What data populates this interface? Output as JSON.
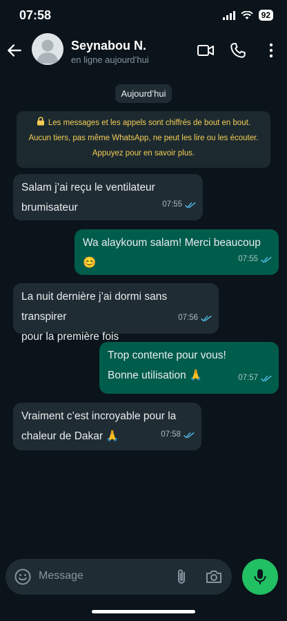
{
  "status_bar": {
    "time": "07:58",
    "battery": "92"
  },
  "header": {
    "contact_name": "Seynabou N.",
    "status": "en ligne aujourd’hui",
    "icons": [
      "back-arrow-icon",
      "video-call-icon",
      "phone-call-icon",
      "more-vertical-icon"
    ]
  },
  "chat": {
    "date_label": "Aujourd’hui",
    "encryption_notice": [
      "Les messages et les appels sont chiffrés de bout en bout.",
      "Aucun tiers, pas même WhatsApp, ne peut les lire ou les écouter.",
      "Appuyez pour en savoir plus."
    ],
    "messages": [
      {
        "direction": "in",
        "lines": [
          "Salam j’ai reçu le ventilateur",
          "brumisateur"
        ],
        "time": "07:55"
      },
      {
        "direction": "out",
        "lines": [
          "Wa alaykoum salam! Merci beaucoup 😊"
        ],
        "time": "07:55"
      },
      {
        "direction": "in",
        "lines": [
          "La nuit dernière j’ai dormi sans transpirer",
          "pour la première fois"
        ],
        "time": "07:56"
      },
      {
        "direction": "out",
        "lines": [
          "Trop contente pour vous!",
          "Bonne utilisation 🙏"
        ],
        "time": "07:57"
      },
      {
        "direction": "in",
        "lines": [
          "Vraiment c’est incroyable pour la",
          "chaleur de Dakar 🙏"
        ],
        "time": "07:58"
      }
    ]
  },
  "composer": {
    "placeholder": "Message"
  },
  "colors": {
    "background": "#0b141a",
    "incoming": "#202c33",
    "outgoing": "#005c4b",
    "accent": "#21c063",
    "read_ticks": "#53bdeb",
    "notice_text": "#f7cd55"
  }
}
